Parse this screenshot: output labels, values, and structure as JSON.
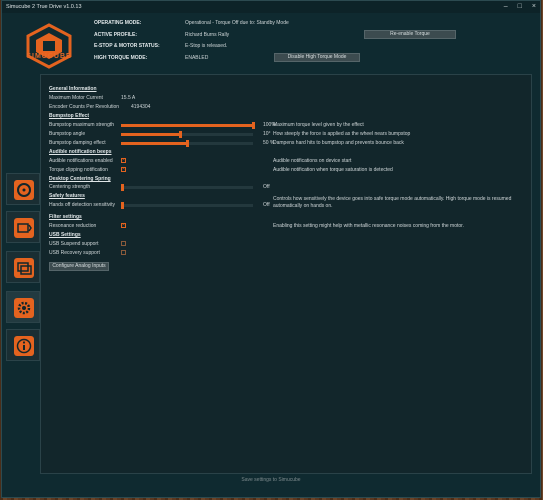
{
  "window": {
    "title": "Simucube 2 True Drive v1.0.13"
  },
  "brand": {
    "name": "SIMUCUBE"
  },
  "status": {
    "operating_mode": {
      "label": "OPERATING MODE:",
      "value": "Operational - Torque Off due to: Standby Mode"
    },
    "active_profile": {
      "label": "ACTIVE PROFILE:",
      "value": "Richard Burns Rally"
    },
    "estop": {
      "label": "E-STOP & MOTOR STATUS:",
      "value": "E-Stop is released."
    },
    "high_torque": {
      "label": "HIGH TORQUE MODE:",
      "value": "ENABLED"
    },
    "reenable_btn": "Re-enable Torque",
    "disable_ht_btn": "Disable High Torque Mode"
  },
  "general": {
    "heading": "General Information",
    "max_current_label": "Maximum Motor Current",
    "max_current_value": "15.5 A",
    "encoder_label": "Encoder Counts Per Revolution",
    "encoder_value": "4194304"
  },
  "bumpstop": {
    "heading": "Bumpstop Effect",
    "rows": [
      {
        "label": "Bumpstop maximum strength",
        "value_text": "100%",
        "fraction": 1.0,
        "desc": "Maximum torque level given by the effect"
      },
      {
        "label": "Bumpstop angle",
        "value_text": "10°",
        "fraction": 0.45,
        "desc": "How steeply the force is applied as the wheel nears bumpstop"
      },
      {
        "label": "Bumpstop damping effect",
        "value_text": "50 %",
        "fraction": 0.5,
        "desc": "Dampens hard hits to bumpstop and prevents bounce back"
      }
    ]
  },
  "audible": {
    "heading": "Audible notification beeps",
    "enabled_label": "Audible notifications enabled",
    "enabled_desc": "Audible notifications on device start",
    "clipping_label": "Torque clipping notification",
    "clipping_desc": "Audible notification when torque saturation is detected"
  },
  "centering": {
    "heading": "Desktop Centering Spring",
    "label": "Centering strength",
    "value_text": "Off",
    "fraction": 0.0
  },
  "safety": {
    "heading": "Safety features",
    "label": "Hands off detection sensitivity",
    "value_text": "Off",
    "fraction": 0.0,
    "desc1": "Controls how sensitively the device goes into safe torque mode automatically. High torque mode is resumed",
    "desc2": "automatically on hands on."
  },
  "filter": {
    "heading": "Filter settings",
    "label": "Resonance reduction",
    "desc": "Enabling this setting might help with metallic resonance noises coming from the motor."
  },
  "usb": {
    "heading": "USB Settings",
    "suspend_label": "USB Suspend support",
    "recovery_label": "USB Recovery support"
  },
  "configure_btn": "Configure Analog Inputs",
  "footer": "Save settings to Simucube",
  "colors": {
    "accent": "#e4631f",
    "bg": "#0f2a30"
  }
}
